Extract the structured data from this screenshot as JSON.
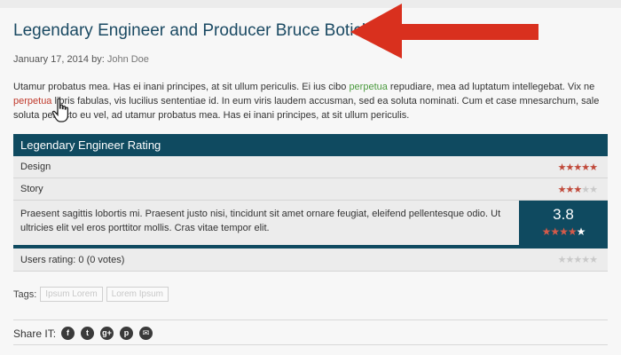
{
  "post": {
    "title": "Legendary Engineer and Producer Bruce Boticka",
    "date": "January 17, 2014",
    "by_label": "by:",
    "author": "John Doe",
    "body": {
      "p1": "Utamur probatus mea. Has ei inani principes, at sit ullum periculis. Ei ius cibo ",
      "link1": "perpetua",
      "p2": " repudiare, mea ad luptatum intellegebat. Vix ne ",
      "link2": "perpetua",
      "p3": " libris fabulas, vis lucilius sententiae id. In eum viris laudem accusman, sed ea soluta nominati. Cum et case mnesarchum, sale soluta perfecto eu vel, ad utamur probatus mea. Has ei inani principes, at sit ullum periculis."
    }
  },
  "review": {
    "heading": "Legendary Engineer Rating",
    "criteria": [
      {
        "label": "Design",
        "rating": 4.5,
        "max": 5
      },
      {
        "label": "Story",
        "rating": 3,
        "max": 5
      }
    ],
    "summary": "Praesent sagittis lobortis mi. Praesent justo nisi, tincidunt sit amet ornare feugiat, eleifend pellentesque odio. Ut ultricies elit vel eros porttitor mollis. Cras vitae tempor elit.",
    "score": "3.8",
    "score_stars": 3.8,
    "users_rating": "Users rating: 0 (0 votes)",
    "users_stars": 0
  },
  "tags": {
    "label": "Tags:",
    "items": [
      "Ipsum Lorem",
      "Lorem Ipsum"
    ]
  },
  "share": {
    "label": "Share IT:",
    "icons": [
      "facebook-icon",
      "twitter-icon",
      "google-plus-icon",
      "pinterest-icon",
      "email-icon"
    ],
    "glyphs": [
      "f",
      "t",
      "g+",
      "p",
      "✉"
    ]
  },
  "colors": {
    "accent": "#0f4a60",
    "title": "#1b4a63",
    "star": "#c0493a",
    "link_green": "#4a9a3d",
    "link_red": "#c0392b",
    "arrow": "#d9301e"
  }
}
